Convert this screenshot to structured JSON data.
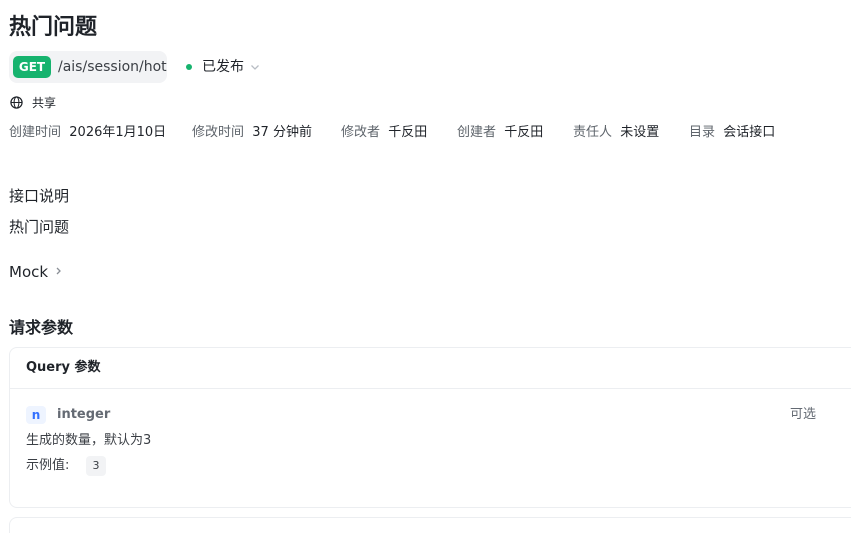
{
  "page": {
    "title": "热门问题"
  },
  "endpoint": {
    "method": "GET",
    "path": "/ais/session/hot",
    "method_color": "#16b36e"
  },
  "status": {
    "label": "已发布",
    "color": "#16b36e"
  },
  "share": {
    "label": "共享",
    "icon": "globe-icon"
  },
  "meta": {
    "created_label": "创建时间",
    "created_value": "2026年1月10日",
    "modified_label": "修改时间",
    "modified_value": "37 分钟前",
    "modifier_label": "修改者",
    "modifier_value": "千反田",
    "creator_label": "创建者",
    "creator_value": "千反田",
    "owner_label": "责任人",
    "owner_value": "未设置",
    "directory_label": "目录",
    "directory_value": "会话接口"
  },
  "description": {
    "heading": "接口说明",
    "text": "热门问题"
  },
  "mock": {
    "label": "Mock"
  },
  "request": {
    "title": "请求参数",
    "query_title": "Query 参数",
    "params": [
      {
        "name": "n",
        "type": "integer",
        "required": "可选",
        "description": "生成的数量，默认为3",
        "example_label": "示例值:",
        "example_value": "3"
      }
    ]
  }
}
